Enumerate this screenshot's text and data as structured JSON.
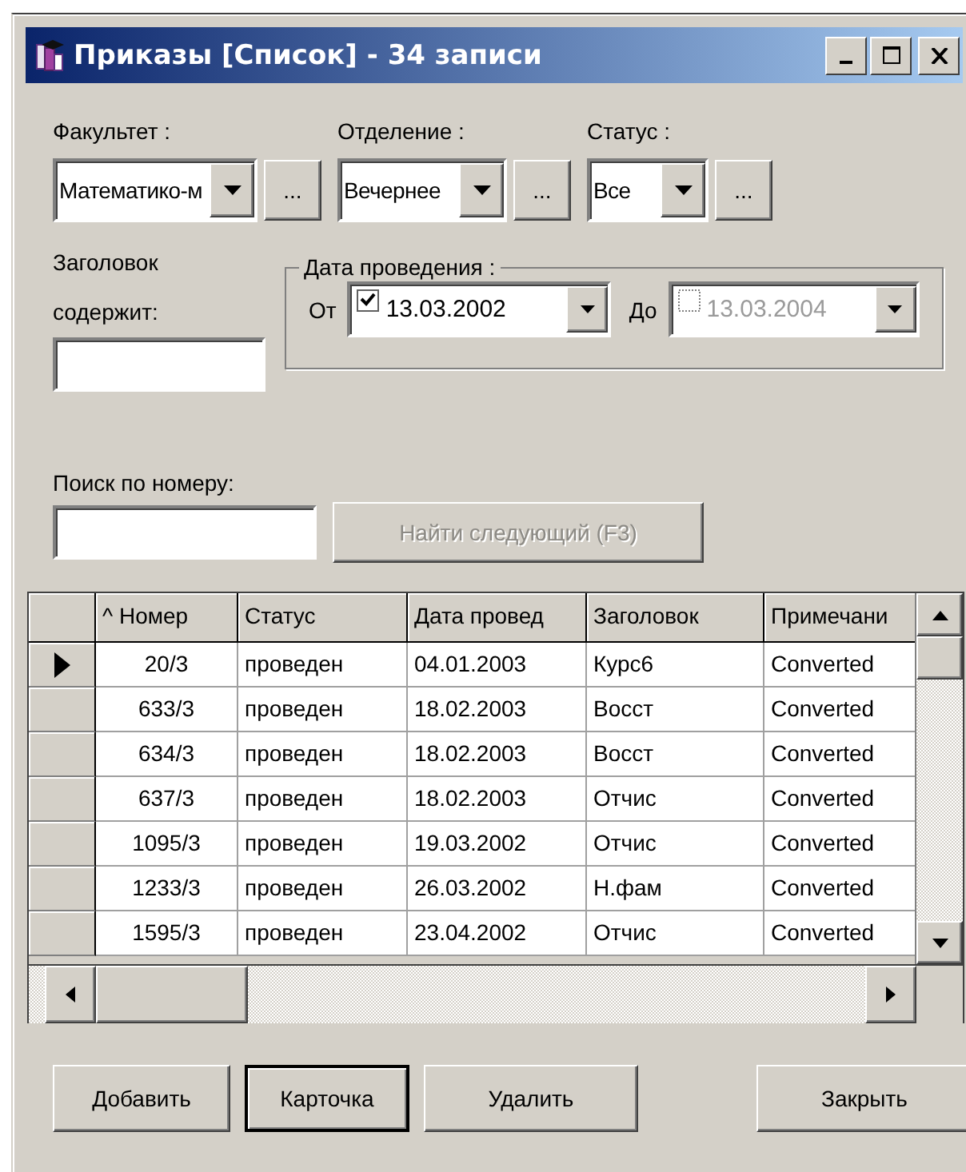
{
  "window": {
    "title": "Приказы [Список] - 34 записи"
  },
  "filters": [
    {
      "label": "Факультет :",
      "value": "Математико-м",
      "button": "..."
    },
    {
      "label": "Отделение :",
      "value": "Вечернее",
      "button": "..."
    },
    {
      "label": "Статус :",
      "value": "Все",
      "button": "..."
    }
  ],
  "title_filter": {
    "label": "Заголовок содержит:"
  },
  "date_range": {
    "label": "Дата проведения :",
    "from": {
      "label": "От",
      "checked": true,
      "value": "13.03.2002"
    },
    "to": {
      "label": "До",
      "checked": false,
      "value": "13.03.2004"
    }
  },
  "number_search": {
    "label": "Поиск по номеру:",
    "button": {
      "label": "Найти следующий (F3)",
      "disabled": true
    }
  },
  "table": {
    "columns": [
      "^ Номер",
      "Статус",
      "Дата провед",
      "Заголовок",
      "Примечани"
    ],
    "rows": [
      {
        "selected": true,
        "cells": [
          "20/3",
          "проведен",
          "04.01.2003",
          "Курс6",
          "Converted"
        ]
      },
      {
        "selected": false,
        "cells": [
          "633/3",
          "проведен",
          "18.02.2003",
          "Восст",
          "Converted"
        ]
      },
      {
        "selected": false,
        "cells": [
          "634/3",
          "проведен",
          "18.02.2003",
          "Восст",
          "Converted"
        ]
      },
      {
        "selected": false,
        "cells": [
          "637/3",
          "проведен",
          "18.02.2003",
          "Отчис",
          "Converted"
        ]
      },
      {
        "selected": false,
        "cells": [
          "1095/3",
          "проведен",
          "19.03.2002",
          "Отчис",
          "Converted"
        ]
      },
      {
        "selected": false,
        "cells": [
          "1233/3",
          "проведен",
          "26.03.2002",
          "Н.фам",
          "Converted"
        ]
      },
      {
        "selected": false,
        "cells": [
          "1595/3",
          "проведен",
          "23.04.2002",
          "Отчис",
          "Converted"
        ]
      }
    ]
  },
  "buttons": [
    {
      "label": "Добавить",
      "default": false
    },
    {
      "label": "Карточка",
      "default": true
    },
    {
      "label": "Удалить",
      "default": false
    },
    {
      "label": "Закрыть",
      "default": false
    }
  ]
}
